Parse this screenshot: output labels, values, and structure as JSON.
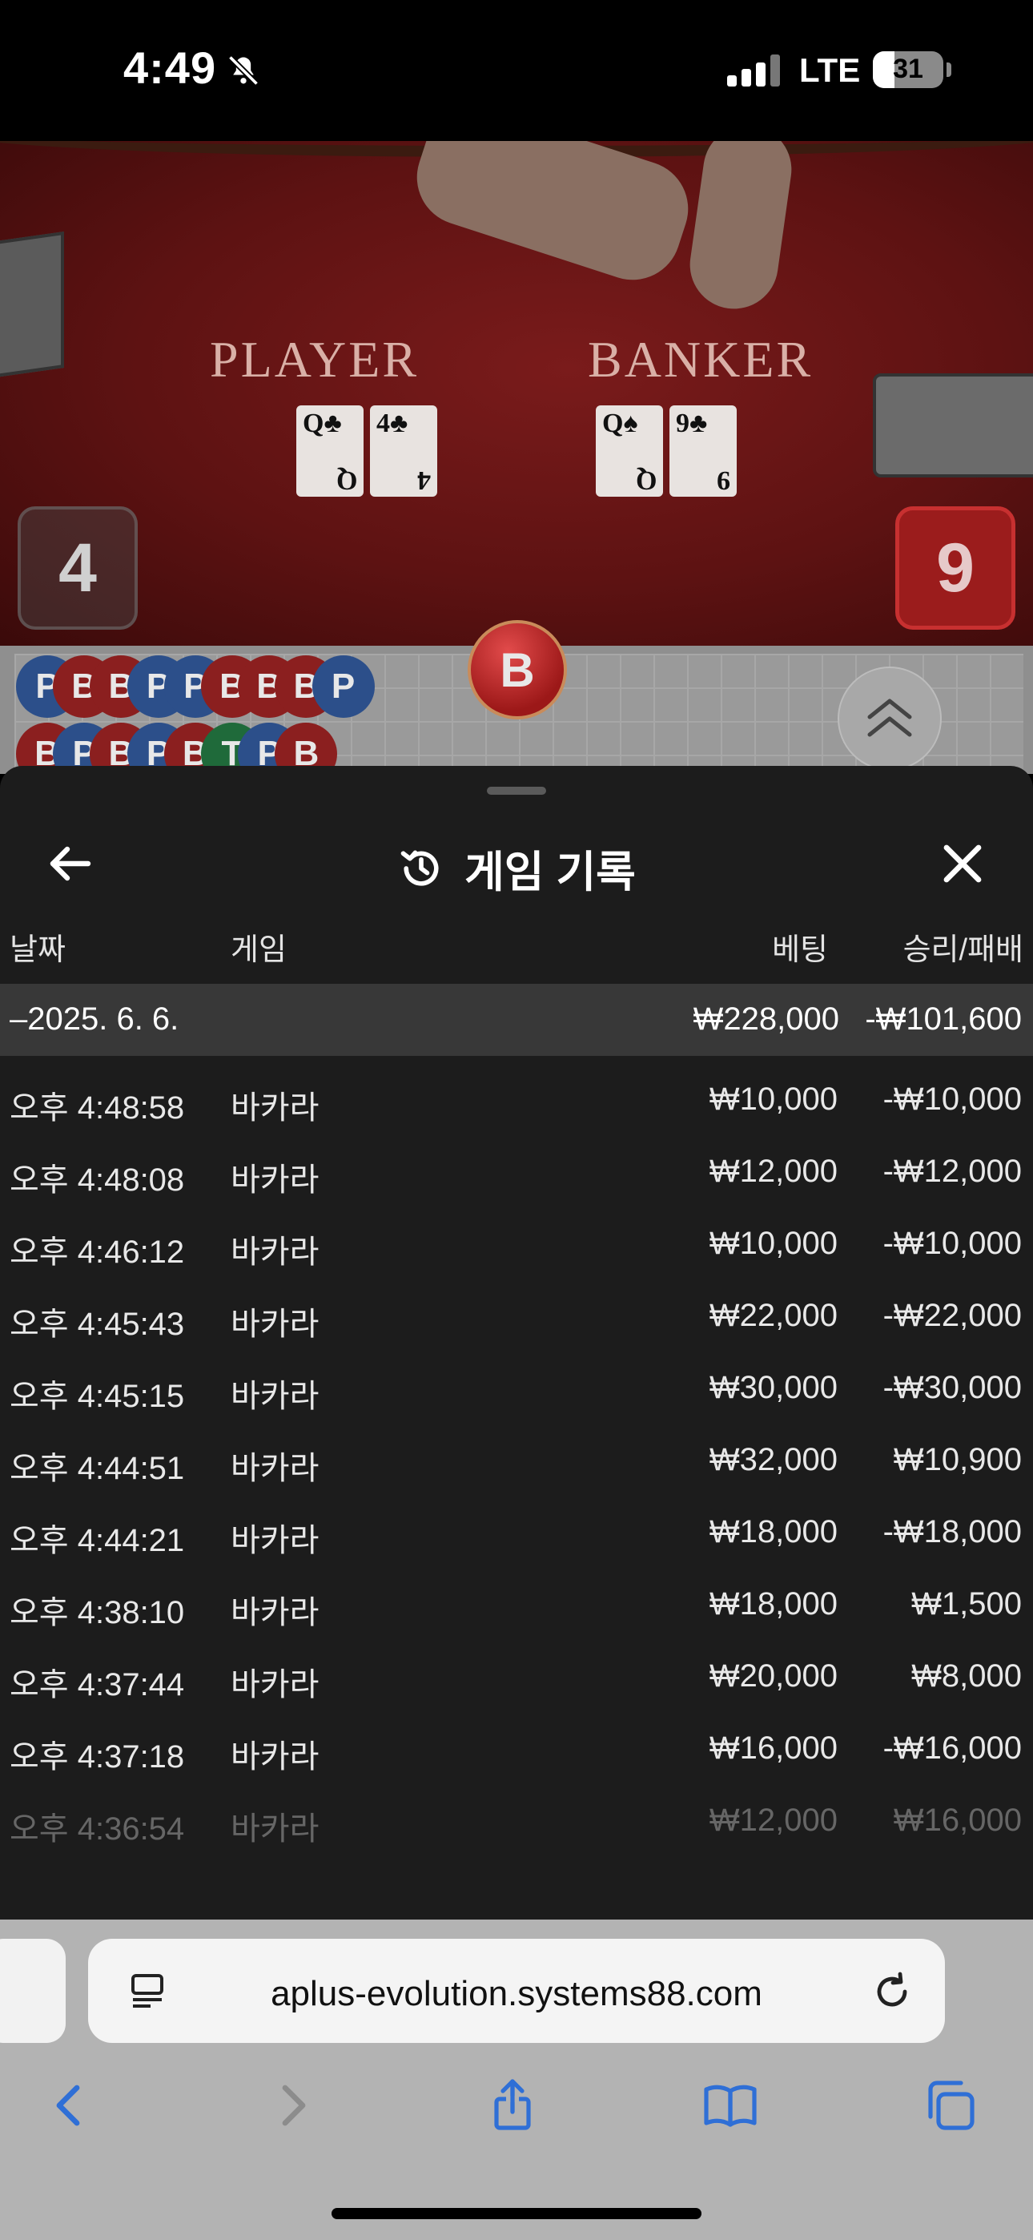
{
  "status_bar": {
    "time": "4:49",
    "network": "LTE",
    "battery_level": "31"
  },
  "video": {
    "player_label": "PLAYER",
    "banker_label": "BANKER",
    "player_cards": [
      {
        "rank": "Q",
        "suit": "♣"
      },
      {
        "rank": "4",
        "suit": "♣"
      }
    ],
    "banker_cards": [
      {
        "rank": "Q",
        "suit": "♠"
      },
      {
        "rank": "9",
        "suit": "♣"
      }
    ],
    "player_score": "4",
    "banker_score": "9"
  },
  "roadmap": {
    "row1": [
      "P",
      "B",
      "B",
      "P",
      "P",
      "B",
      "B",
      "B",
      "P"
    ],
    "row2": [
      "B",
      "P",
      "B",
      "P",
      "B",
      "T",
      "P",
      "B"
    ],
    "latest": "B"
  },
  "sheet": {
    "title": "게임 기록",
    "columns": {
      "date": "날짜",
      "game": "게임",
      "bet": "베팅",
      "win_loss": "승리/패배"
    },
    "day_summary": {
      "date": "–2025. 6. 6.",
      "bet": "₩228,000",
      "win_loss": "-₩101,600"
    },
    "rows": [
      {
        "time": "오후 4:48:58",
        "game": "바카라",
        "bet": "₩10,000",
        "win_loss": "-₩10,000"
      },
      {
        "time": "오후 4:48:08",
        "game": "바카라",
        "bet": "₩12,000",
        "win_loss": "-₩12,000"
      },
      {
        "time": "오후 4:46:12",
        "game": "바카라",
        "bet": "₩10,000",
        "win_loss": "-₩10,000"
      },
      {
        "time": "오후 4:45:43",
        "game": "바카라",
        "bet": "₩22,000",
        "win_loss": "-₩22,000"
      },
      {
        "time": "오후 4:45:15",
        "game": "바카라",
        "bet": "₩30,000",
        "win_loss": "-₩30,000"
      },
      {
        "time": "오후 4:44:51",
        "game": "바카라",
        "bet": "₩32,000",
        "win_loss": "₩10,900"
      },
      {
        "time": "오후 4:44:21",
        "game": "바카라",
        "bet": "₩18,000",
        "win_loss": "-₩18,000"
      },
      {
        "time": "오후 4:38:10",
        "game": "바카라",
        "bet": "₩18,000",
        "win_loss": "₩1,500"
      },
      {
        "time": "오후 4:37:44",
        "game": "바카라",
        "bet": "₩20,000",
        "win_loss": "₩8,000"
      },
      {
        "time": "오후 4:37:18",
        "game": "바카라",
        "bet": "₩16,000",
        "win_loss": "-₩16,000"
      },
      {
        "time": "오후 4:36:54",
        "game": "바카라",
        "bet": "₩12,000",
        "win_loss": "₩16,000"
      }
    ]
  },
  "browser": {
    "url": "aplus-evolution.systems88.com"
  }
}
